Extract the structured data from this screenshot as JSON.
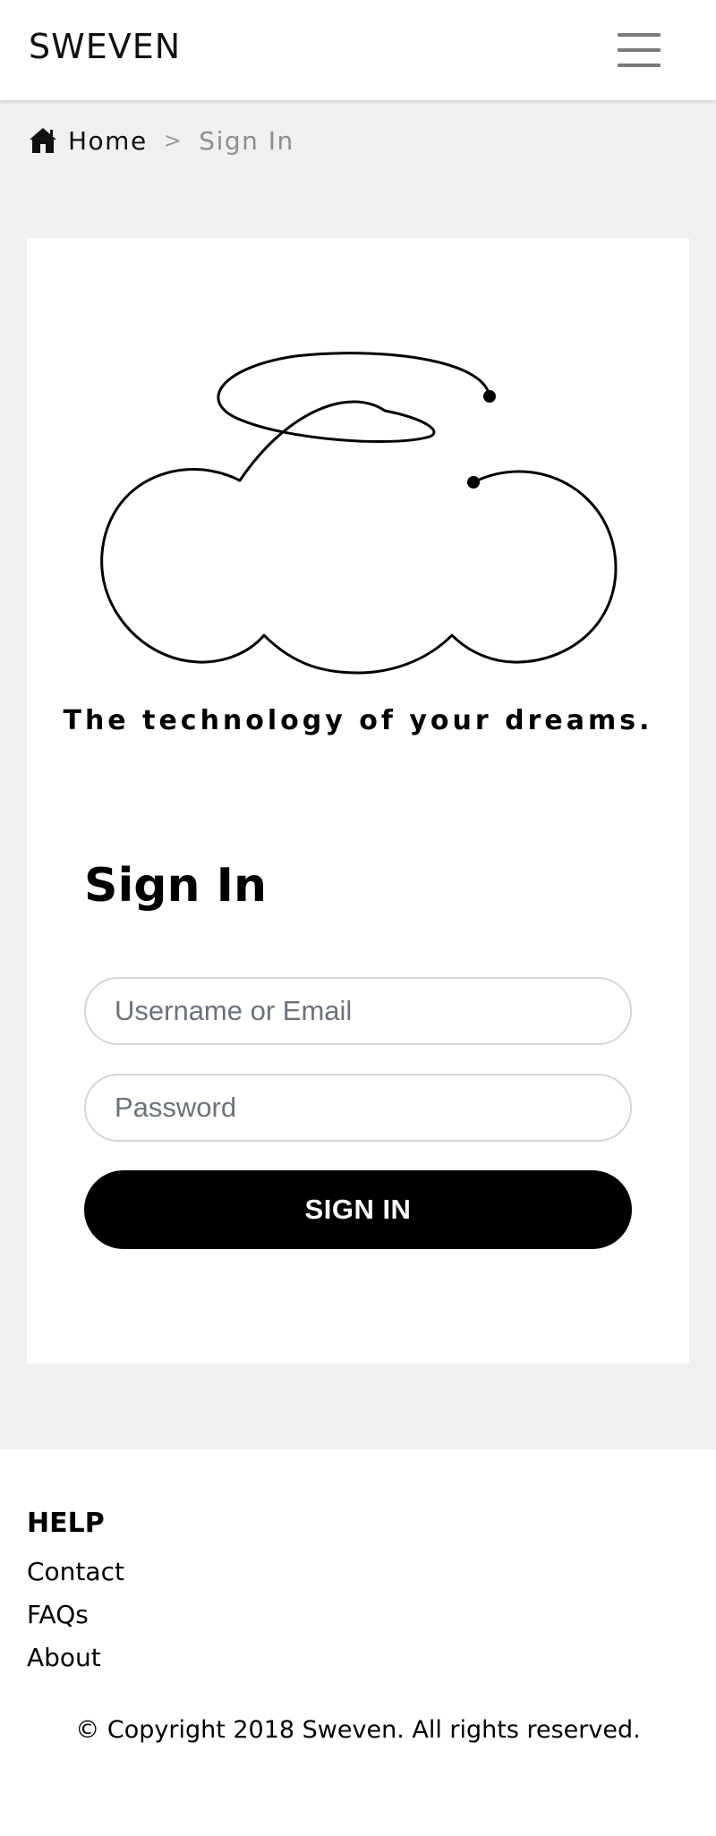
{
  "navbar": {
    "brand": "SWEVEN",
    "menu_icon": "hamburger-menu-icon"
  },
  "breadcrumb": {
    "home_icon": "home-icon",
    "home": "Home",
    "separator": ">",
    "current": "Sign In"
  },
  "hero": {
    "logo": "cloud-logo",
    "tagline": "The technology of your dreams."
  },
  "signin": {
    "title": "Sign In",
    "username_placeholder": "Username or Email",
    "password_placeholder": "Password",
    "button_label": "SIGN IN"
  },
  "footer": {
    "heading": "HELP",
    "links": [
      "Contact",
      "FAQs",
      "About"
    ],
    "copyright": "© Copyright 2018 Sweven. All rights reserved."
  },
  "colors": {
    "page_background": "#f0f0f0",
    "button": "#000000",
    "button_text": "#ffffff",
    "breadcrumb_current": "#8e8e8e"
  }
}
